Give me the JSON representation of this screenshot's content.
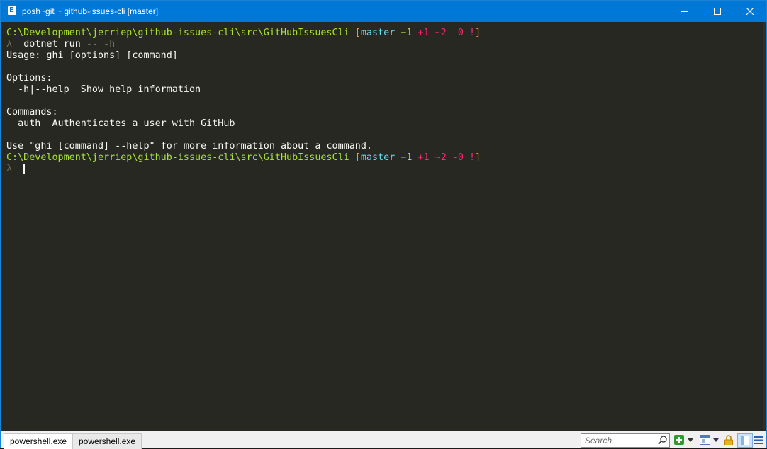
{
  "window": {
    "title": "posh~git ~ github-issues-cli [master]",
    "app_icon_glyph": "E",
    "accent_color": "#0078d7"
  },
  "terminal": {
    "background": "#272822",
    "lines": [
      {
        "segments": [
          {
            "text": "C:\\Development\\jerriep\\github-issues-cli\\src\\GitHubIssuesCli ",
            "color": "green"
          },
          {
            "text": "[",
            "color": "orange"
          },
          {
            "text": "master",
            "color": "cyan"
          },
          {
            "text": " ",
            "color": "white"
          },
          {
            "text": "−1",
            "color": "green"
          },
          {
            "text": " +1 ~2 -0 ",
            "color": "red"
          },
          {
            "text": "!",
            "color": "red"
          },
          {
            "text": "]",
            "color": "orange"
          }
        ]
      },
      {
        "segments": [
          {
            "text": "λ  ",
            "color": "gray"
          },
          {
            "text": "dotnet run ",
            "color": "white"
          },
          {
            "text": "-- -h",
            "color": "gray"
          }
        ]
      },
      {
        "segments": [
          {
            "text": "Usage: ghi [options] [command]",
            "color": "white"
          }
        ]
      },
      {
        "segments": [
          {
            "text": "",
            "color": "white"
          }
        ]
      },
      {
        "segments": [
          {
            "text": "Options:",
            "color": "white"
          }
        ]
      },
      {
        "segments": [
          {
            "text": "  -h|--help  Show help information",
            "color": "white"
          }
        ]
      },
      {
        "segments": [
          {
            "text": "",
            "color": "white"
          }
        ]
      },
      {
        "segments": [
          {
            "text": "Commands:",
            "color": "white"
          }
        ]
      },
      {
        "segments": [
          {
            "text": "  auth  Authenticates a user with GitHub",
            "color": "white"
          }
        ]
      },
      {
        "segments": [
          {
            "text": "",
            "color": "white"
          }
        ]
      },
      {
        "segments": [
          {
            "text": "Use \"ghi [command] --help\" for more information about a command.",
            "color": "white"
          }
        ]
      },
      {
        "segments": [
          {
            "text": "C:\\Development\\jerriep\\github-issues-cli\\src\\GitHubIssuesCli ",
            "color": "green"
          },
          {
            "text": "[",
            "color": "orange"
          },
          {
            "text": "master",
            "color": "cyan"
          },
          {
            "text": " ",
            "color": "white"
          },
          {
            "text": "−1",
            "color": "green"
          },
          {
            "text": " +1 ~2 -0 ",
            "color": "red"
          },
          {
            "text": "!",
            "color": "red"
          },
          {
            "text": "]",
            "color": "orange"
          }
        ]
      },
      {
        "segments": [
          {
            "text": "λ  ",
            "color": "gray"
          }
        ],
        "cursor": true
      }
    ]
  },
  "statusbar": {
    "tabs": [
      {
        "label": "powershell.exe",
        "active": true
      },
      {
        "label": "powershell.exe",
        "active": false
      }
    ],
    "search_placeholder": "Search"
  }
}
